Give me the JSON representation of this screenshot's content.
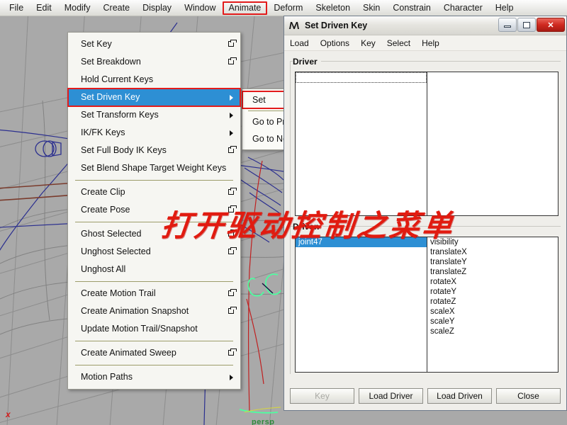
{
  "app": {
    "menubar": [
      {
        "label": "File",
        "highlighted": false
      },
      {
        "label": "Edit",
        "highlighted": false
      },
      {
        "label": "Modify",
        "highlighted": false
      },
      {
        "label": "Create",
        "highlighted": false
      },
      {
        "label": "Display",
        "highlighted": false
      },
      {
        "label": "Window",
        "highlighted": false
      },
      {
        "label": "Animate",
        "highlighted": true
      },
      {
        "label": "Deform",
        "highlighted": false
      },
      {
        "label": "Skeleton",
        "highlighted": false
      },
      {
        "label": "Skin",
        "highlighted": false
      },
      {
        "label": "Constrain",
        "highlighted": false
      },
      {
        "label": "Character",
        "highlighted": false
      },
      {
        "label": "Help",
        "highlighted": false
      }
    ]
  },
  "viewport": {
    "camera_label": "persp",
    "axis_label": "x",
    "background_color": "#a9a9a9"
  },
  "animate_menu": {
    "items": [
      {
        "label": "Set Key",
        "option_box": true,
        "arrow": false,
        "selected": false
      },
      {
        "label": "Set Breakdown",
        "option_box": true,
        "arrow": false,
        "selected": false
      },
      {
        "label": "Hold Current Keys",
        "option_box": false,
        "arrow": false,
        "selected": false
      },
      {
        "label": "Set Driven Key",
        "option_box": false,
        "arrow": true,
        "selected": true
      },
      {
        "label": "Set Transform Keys",
        "option_box": false,
        "arrow": true,
        "selected": false
      },
      {
        "label": "IK/FK Keys",
        "option_box": false,
        "arrow": true,
        "selected": false
      },
      {
        "label": "Set Full Body IK Keys",
        "option_box": true,
        "arrow": false,
        "selected": false
      },
      {
        "label": "Set Blend Shape Target Weight Keys",
        "option_box": false,
        "arrow": false,
        "selected": false
      },
      {
        "separator": true
      },
      {
        "label": "Create Clip",
        "option_box": true,
        "arrow": false,
        "selected": false
      },
      {
        "label": "Create Pose",
        "option_box": true,
        "arrow": false,
        "selected": false
      },
      {
        "separator": true
      },
      {
        "label": "Ghost Selected",
        "option_box": true,
        "arrow": false,
        "selected": false
      },
      {
        "label": "Unghost Selected",
        "option_box": true,
        "arrow": false,
        "selected": false
      },
      {
        "label": "Unghost All",
        "option_box": false,
        "arrow": false,
        "selected": false
      },
      {
        "separator": true
      },
      {
        "label": "Create Motion Trail",
        "option_box": true,
        "arrow": false,
        "selected": false
      },
      {
        "label": "Create Animation Snapshot",
        "option_box": true,
        "arrow": false,
        "selected": false
      },
      {
        "label": "Update Motion Trail/Snapshot",
        "option_box": false,
        "arrow": false,
        "selected": false
      },
      {
        "separator": true
      },
      {
        "label": "Create Animated Sweep",
        "option_box": true,
        "arrow": false,
        "selected": false
      },
      {
        "separator": true
      },
      {
        "label": "Motion Paths",
        "option_box": false,
        "arrow": true,
        "selected": false
      }
    ]
  },
  "driven_key_submenu": {
    "items": [
      {
        "label": "Set",
        "highlighted": true
      },
      {
        "separator": true
      },
      {
        "label": "Go to Pr",
        "highlighted": false
      },
      {
        "label": "Go to Ne",
        "highlighted": false
      }
    ]
  },
  "set_driven_key_window": {
    "title": "Set Driven Key",
    "window_icon": "maya-app-icon",
    "window_buttons": {
      "minimize": "minimize-icon",
      "maximize": "maximize-icon",
      "close": "✕"
    },
    "menu": [
      "Load",
      "Options",
      "Key",
      "Select",
      "Help"
    ],
    "driver": {
      "label": "Driver",
      "objects": [
        ""
      ],
      "attributes": []
    },
    "driven": {
      "label": "Driven",
      "objects": [
        "joint47"
      ],
      "selected_object": "joint47",
      "attributes": [
        "visibility",
        "translateX",
        "translateY",
        "translateZ",
        "rotateX",
        "rotateY",
        "rotateZ",
        "scaleX",
        "scaleY",
        "scaleZ"
      ]
    },
    "buttons": [
      {
        "label": "Key",
        "disabled": true
      },
      {
        "label": "Load Driver",
        "disabled": false
      },
      {
        "label": "Load Driven",
        "disabled": false
      },
      {
        "label": "Close",
        "disabled": false
      }
    ]
  },
  "annotation": {
    "text": "打开驱动控制之菜单",
    "color": "#e11b10"
  },
  "colors": {
    "selection_blue": "#2d8fd4",
    "highlight_red": "#e21b1b",
    "viewport_grey": "#a9a9a9",
    "panel_grey": "#efeeea"
  }
}
